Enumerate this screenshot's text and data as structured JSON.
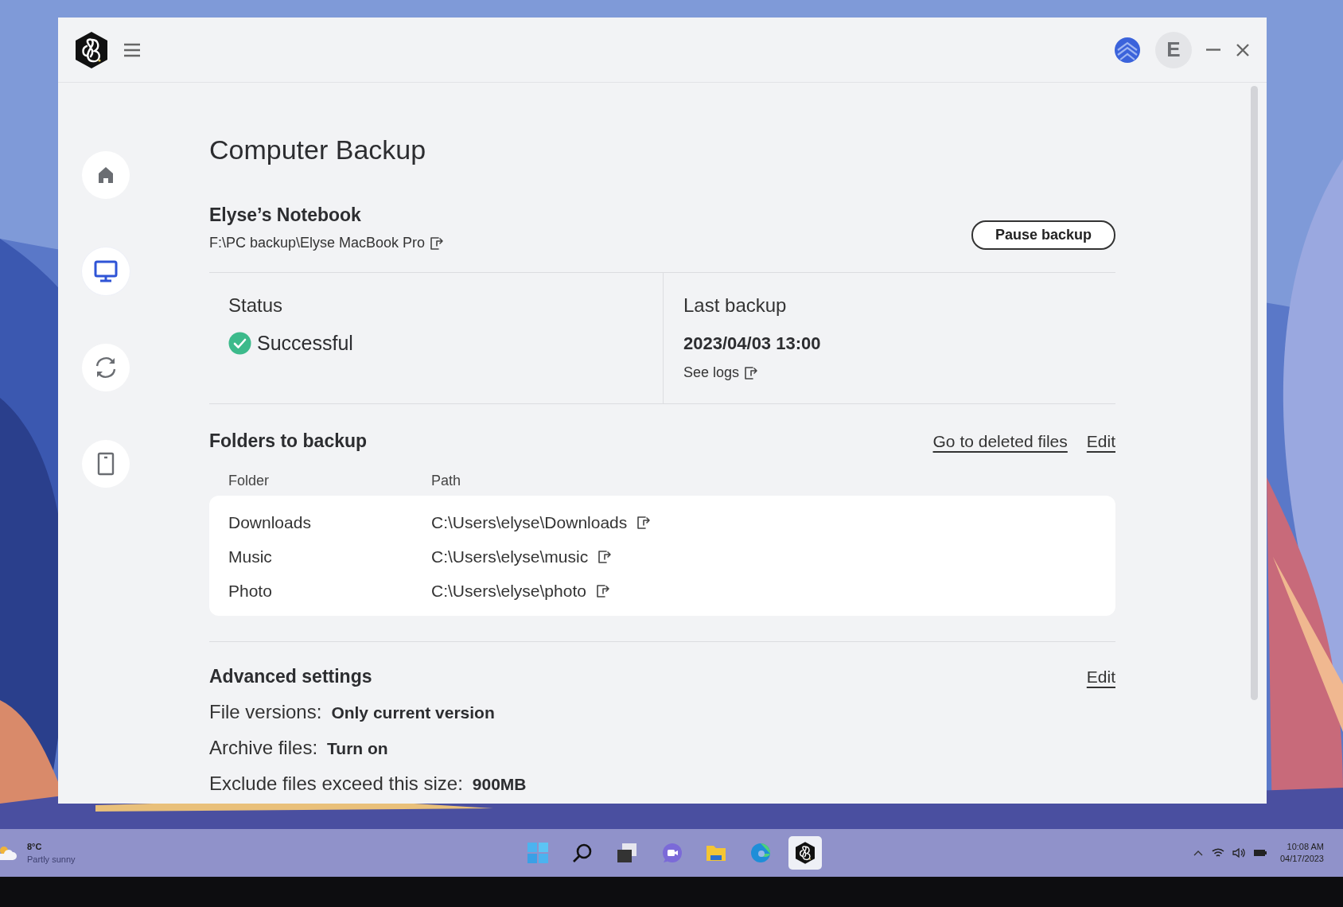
{
  "header": {
    "avatar_initial": "E"
  },
  "sidebar": {
    "items": [
      {
        "kind": "home",
        "selected": false
      },
      {
        "kind": "computer",
        "selected": true
      },
      {
        "kind": "sync",
        "selected": false
      },
      {
        "kind": "device",
        "selected": false
      }
    ]
  },
  "page": {
    "title": "Computer Backup",
    "device": {
      "name": "Elyse’s Notebook",
      "path": "F:\\PC backup\\Elyse MacBook Pro",
      "button": "Pause backup"
    },
    "status": {
      "label": "Status",
      "success": true,
      "value": "Successful"
    },
    "last_backup": {
      "label": "Last backup",
      "value": "2023/04/03 13:00",
      "link": "See logs"
    },
    "folders": {
      "title": "Folders to backup",
      "links": [
        "Go to deleted files",
        "Edit"
      ],
      "columns": [
        "Folder",
        "Path"
      ],
      "rows": [
        {
          "folder": "Downloads",
          "path": "C:\\Users\\elyse\\Downloads"
        },
        {
          "folder": "Music",
          "path": "C:\\Users\\elyse\\music"
        },
        {
          "folder": "Photo",
          "path": "C:\\Users\\elyse\\photo"
        }
      ]
    },
    "advanced": {
      "title": "Advanced settings",
      "link": "Edit",
      "settings": [
        {
          "label": "File versions:",
          "value": "Only current version"
        },
        {
          "label": "Archive files:",
          "value": "Turn on"
        },
        {
          "label": "Exclude files exceed this size:",
          "value": "900MB"
        }
      ]
    }
  },
  "taskbar": {
    "weather": {
      "temp": "8°C",
      "text": "Partly sunny"
    },
    "apps": [
      {
        "kind": "start",
        "selected": false
      },
      {
        "kind": "search",
        "selected": false
      },
      {
        "kind": "taskview",
        "selected": false
      },
      {
        "kind": "chat",
        "selected": false
      },
      {
        "kind": "explorer",
        "selected": false
      },
      {
        "kind": "browser",
        "selected": false
      },
      {
        "kind": "backup",
        "selected": true
      }
    ],
    "clock": {
      "time": "10:08 AM",
      "date": "04/17/2023"
    }
  }
}
